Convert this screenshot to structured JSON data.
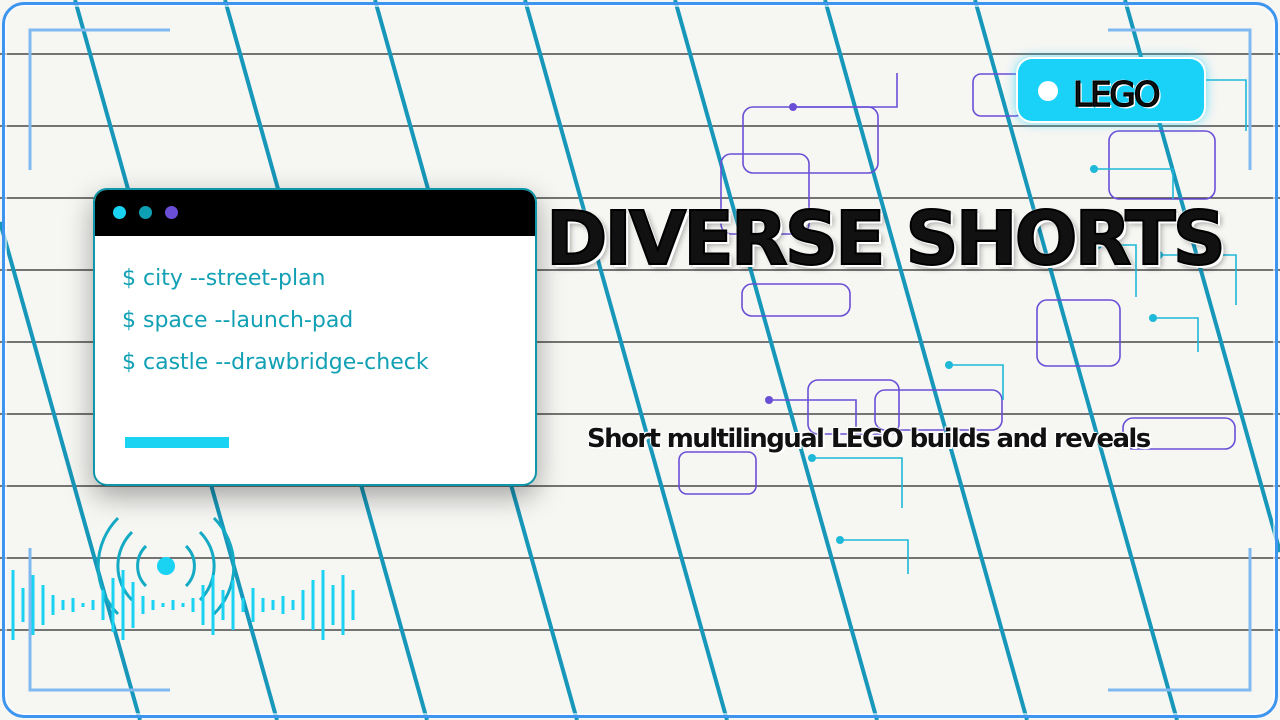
{
  "title": "DIVERSE SHORTS",
  "subtitle": "Short multilingual LEGO builds and reveals",
  "badge": {
    "label": "LEGO"
  },
  "terminal": {
    "commands": [
      "$ city --street-plan",
      "$ space --launch-pad",
      "$ castle --drawbridge-check"
    ],
    "window_dots": [
      "#1ad2f2",
      "#0f9fb3",
      "#6a4fd6"
    ]
  },
  "colors": {
    "accent_cyan": "#1ad2f8",
    "stripe_teal": "#1797b9",
    "circuit_purple": "#6a4fd6",
    "frame_blue": "#3e95f0",
    "text_teal": "#12a0b4"
  },
  "icons": [
    "broadcast-icon",
    "audio-waveform-icon",
    "circuit-pattern"
  ]
}
